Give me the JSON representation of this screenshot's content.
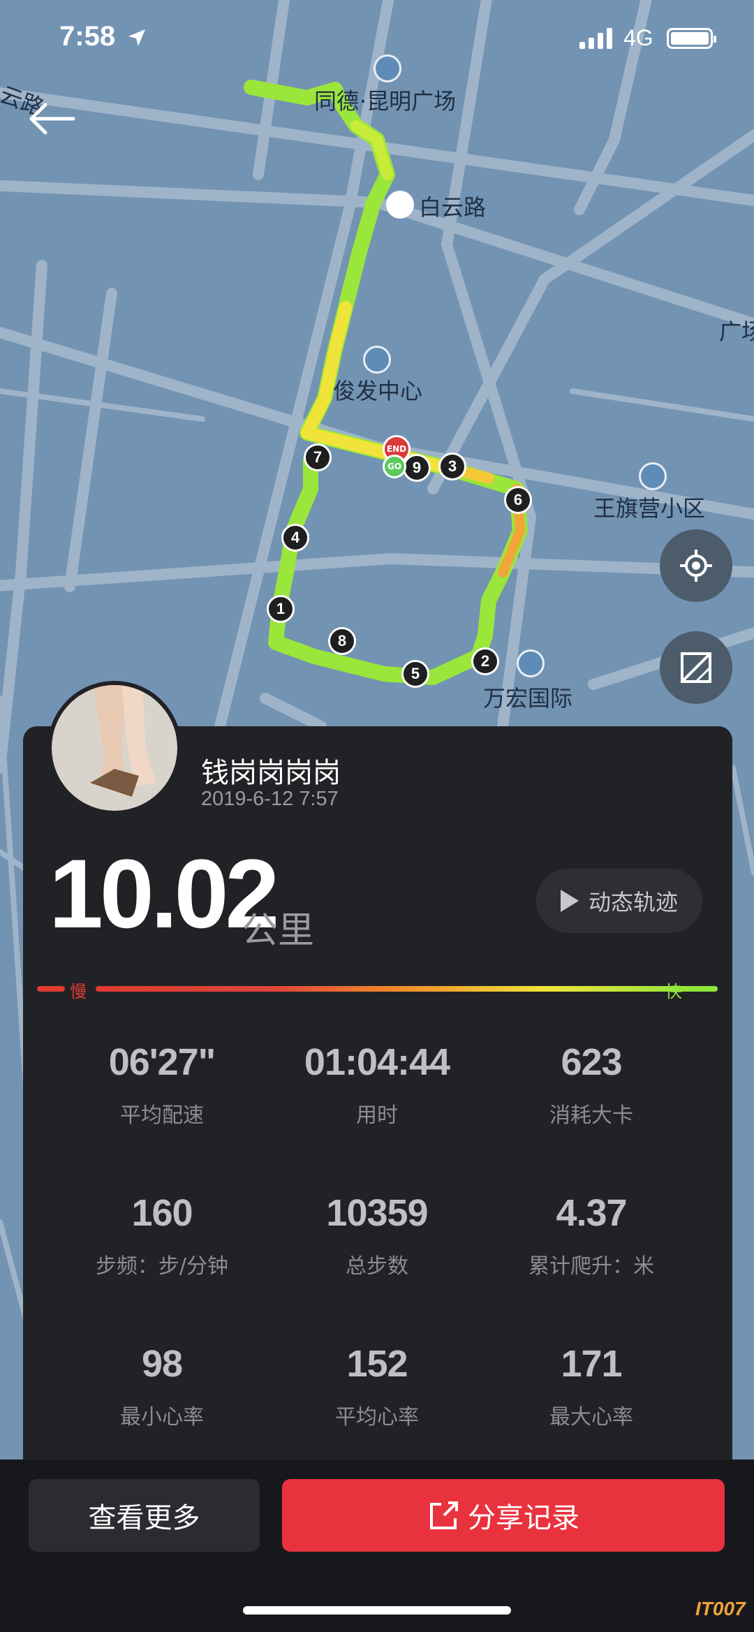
{
  "status_bar": {
    "time": "7:58",
    "network": "4G"
  },
  "map": {
    "labels": {
      "plaza": "·昆明广场",
      "plaza_prefix": "同德",
      "baiyun_station": "白云路",
      "junfa": "俊发中心",
      "wangqi": "王旗营小区",
      "wanhong": "万宏国际",
      "yunlu": "云路",
      "guangchang_edge": "广场"
    },
    "km_markers": [
      "1",
      "2",
      "3",
      "4",
      "5",
      "6",
      "7",
      "8",
      "9"
    ],
    "end_label": "END",
    "go_label": "GO"
  },
  "profile": {
    "name": "钱岗岗岗岗",
    "datetime": "2019-6-12 7:57"
  },
  "summary": {
    "distance": "10.02",
    "unit": "公里",
    "replay_label": "动态轨迹"
  },
  "pace_legend": {
    "slow": "慢",
    "fast": "快"
  },
  "stats": [
    {
      "value": "06'27\"",
      "label": "平均配速"
    },
    {
      "value": "01:04:44",
      "label": "用时"
    },
    {
      "value": "623",
      "label": "消耗大卡"
    },
    {
      "value": "160",
      "label": "步频：步/分钟"
    },
    {
      "value": "10359",
      "label": "总步数"
    },
    {
      "value": "4.37",
      "label": "累计爬升：米"
    },
    {
      "value": "98",
      "label": "最小心率"
    },
    {
      "value": "152",
      "label": "平均心率"
    },
    {
      "value": "171",
      "label": "最大心率"
    }
  ],
  "actions": {
    "more": "查看更多",
    "share": "分享记录"
  },
  "watermark": "IT007",
  "colors": {
    "accent_red": "#e8333f",
    "fast_green": "#8ee63a",
    "slow_red": "#e03c31",
    "panel": "#212226",
    "map": "#7393b3"
  },
  "icons": [
    "location-arrow-icon",
    "signal-icon",
    "battery-icon",
    "back-arrow-icon",
    "locate-icon",
    "map-layers-icon",
    "play-icon",
    "share-icon",
    "poi-building-icon",
    "metro-station-icon"
  ]
}
